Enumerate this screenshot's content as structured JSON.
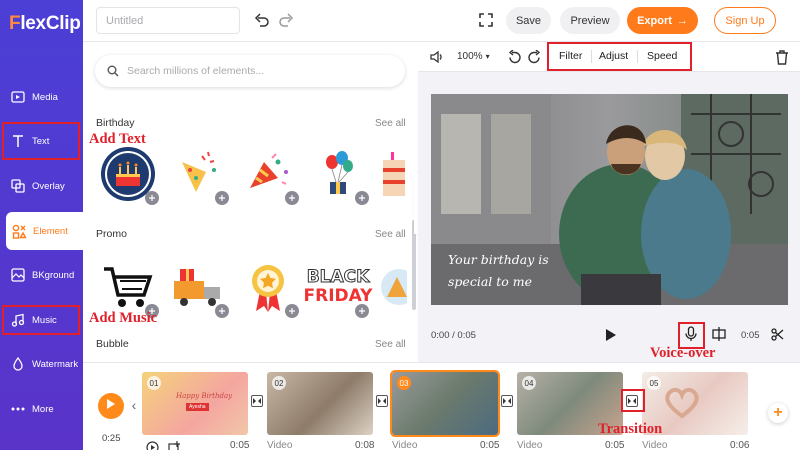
{
  "app": {
    "logo": "FlexClip"
  },
  "sidebar": {
    "items": [
      {
        "label": "Media",
        "icon": "media-icon"
      },
      {
        "label": "Text",
        "icon": "text-icon"
      },
      {
        "label": "Overlay",
        "icon": "overlay-icon"
      },
      {
        "label": "Element",
        "icon": "element-icon",
        "active": true
      },
      {
        "label": "BKground",
        "icon": "background-icon"
      },
      {
        "label": "Music",
        "icon": "music-icon"
      },
      {
        "label": "Watermark",
        "icon": "watermark-icon"
      },
      {
        "label": "More",
        "icon": "more-icon"
      }
    ]
  },
  "topbar": {
    "title_placeholder": "Untitled",
    "save_label": "Save",
    "preview_label": "Preview",
    "export_label": "Export",
    "signup_label": "Sign Up"
  },
  "elements_panel": {
    "search_placeholder": "Search millions of elements...",
    "sections": [
      {
        "title": "Birthday",
        "see_all": "See all"
      },
      {
        "title": "Promo",
        "see_all": "See all"
      },
      {
        "title": "Bubble",
        "see_all": "See all"
      }
    ],
    "promo_text": {
      "line1": "BLACK",
      "line2": "FRIDAY"
    }
  },
  "editor_toolbar": {
    "zoom": "100%",
    "tabs": [
      "Filter",
      "Adjust",
      "Speed"
    ]
  },
  "preview": {
    "caption_line1": "Your birthday is",
    "caption_line2": "special to me",
    "current_time": "0:00 / 0:05",
    "duration": "0:05"
  },
  "timeline": {
    "total_time": "0:25",
    "clips": [
      {
        "num": "01",
        "type": "",
        "duration": "0:05",
        "card_line1": "Happy Birthday",
        "card_line2": "Ayesha"
      },
      {
        "num": "02",
        "type": "Video",
        "duration": "0:08"
      },
      {
        "num": "03",
        "type": "Video",
        "duration": "0:05",
        "selected": true
      },
      {
        "num": "04",
        "type": "Video",
        "duration": "0:05"
      },
      {
        "num": "05",
        "type": "Video",
        "duration": "0:06"
      }
    ]
  },
  "annotations": {
    "add_text": "Add Text",
    "add_music": "Add Music",
    "voice_over": "Voice-over",
    "transition": "Transition"
  },
  "colors": {
    "sidebar": "#4b3fd6",
    "accent": "#ff7a1a",
    "annotation": "#e0202a"
  }
}
